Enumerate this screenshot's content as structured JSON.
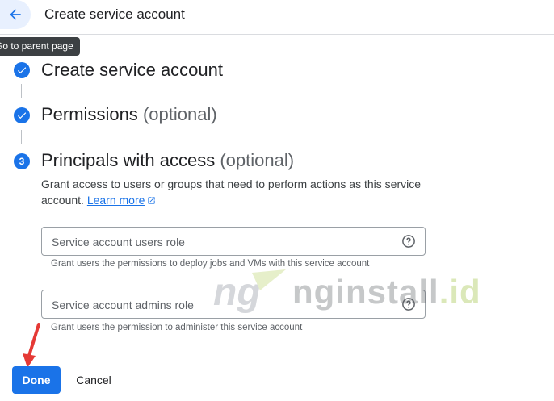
{
  "header": {
    "title": "Create service account"
  },
  "tooltip": "Go to parent page",
  "steps": [
    {
      "title": "Create service account",
      "optional": ""
    },
    {
      "title": "Permissions",
      "optional": "(optional)"
    },
    {
      "number": "3",
      "title": "Principals with access",
      "optional": "(optional)"
    }
  ],
  "description": {
    "text": "Grant access to users or groups that need to perform actions as this service account.",
    "link": "Learn more"
  },
  "fields": [
    {
      "placeholder": "Service account users role",
      "hint": "Grant users the permissions to deploy jobs and VMs with this service account"
    },
    {
      "placeholder": "Service account admins role",
      "hint": "Grant users the permission to administer this service account"
    }
  ],
  "actions": {
    "done": "Done",
    "cancel": "Cancel"
  },
  "watermark": {
    "logo": "ng",
    "text": "nginstall",
    "suffix": ".id"
  },
  "colors": {
    "accent": "#1a73e8",
    "annotation": "#e53935"
  }
}
